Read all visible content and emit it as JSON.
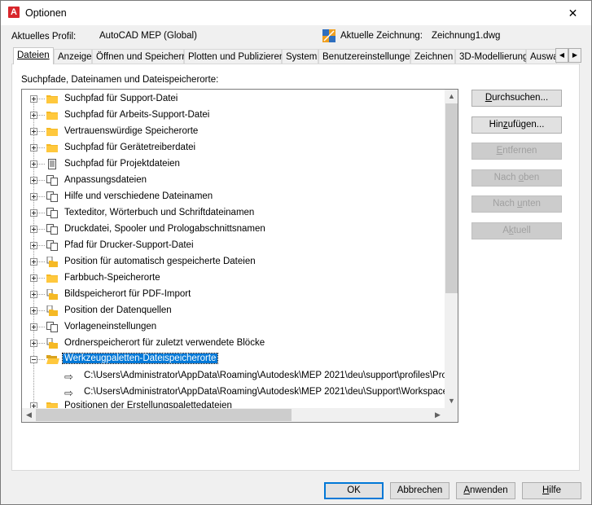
{
  "window": {
    "title": "Optionen",
    "close_glyph": "✕"
  },
  "profile": {
    "label": "Aktuelles Profil:",
    "value": "AutoCAD MEP (Global)",
    "drawing_label": "Aktuelle Zeichnung:",
    "drawing_value": "Zeichnung1.dwg"
  },
  "tabs": [
    "Dateien",
    "Anzeige",
    "Öffnen und Speichern",
    "Plotten und Publizieren",
    "System",
    "Benutzereinstellungen",
    "Zeichnen",
    "3D-Modellierung",
    "Auswa"
  ],
  "section_label": "Suchpfade, Dateinamen und Dateispeicherorte:",
  "tree": {
    "items": [
      {
        "label": "Suchpfad für Support-Datei",
        "icon": "folder-icon"
      },
      {
        "label": "Suchpfad für Arbeits-Support-Datei",
        "icon": "folder-icon"
      },
      {
        "label": "Vertrauenswürdige Speicherorte",
        "icon": "folder-icon"
      },
      {
        "label": "Suchpfad für Gerätetreiberdatei",
        "icon": "folder-icon"
      },
      {
        "label": "Suchpfad für Projektdateien",
        "icon": "document-stack-icon"
      },
      {
        "label": "Anpassungsdateien",
        "icon": "files-icon"
      },
      {
        "label": "Hilfe und verschiedene Dateinamen",
        "icon": "files-icon"
      },
      {
        "label": "Texteditor, Wörterbuch und Schriftdateinamen",
        "icon": "files-icon"
      },
      {
        "label": "Druckdatei, Spooler und Prologabschnittsnamen",
        "icon": "files-icon"
      },
      {
        "label": "Pfad für Drucker-Support-Datei",
        "icon": "files-icon"
      },
      {
        "label": "Position für automatisch gespeicherte Dateien",
        "icon": "folder-file-icon"
      },
      {
        "label": "Farbbuch-Speicherorte",
        "icon": "folder-icon"
      },
      {
        "label": "Bildspeicherort für PDF-Import",
        "icon": "folder-file-icon"
      },
      {
        "label": "Position der Datenquellen",
        "icon": "folder-file-icon"
      },
      {
        "label": "Vorlageneinstellungen",
        "icon": "files-icon"
      },
      {
        "label": "Ordnerspeicherort für zuletzt verwendete Blöcke",
        "icon": "folder-file-icon"
      },
      {
        "label": "Werkzeugpaletten-Dateispeicherorte",
        "icon": "open-folder-icon",
        "selected": true
      }
    ],
    "subitems": [
      "C:\\Users\\Administrator\\AppData\\Roaming\\Autodesk\\MEP 2021\\deu\\support\\profiles\\Projec",
      "C:\\Users\\Administrator\\AppData\\Roaming\\Autodesk\\MEP 2021\\deu\\Support\\WorkspaceCa"
    ],
    "partial_item": "Positionen der Erstellungspalettedateien"
  },
  "side_buttons": {
    "browse": {
      "pre": "",
      "key": "D",
      "post": "urchsuchen..."
    },
    "add": {
      "pre": "Hin",
      "key": "z",
      "post": "ufügen..."
    },
    "remove": {
      "pre": "",
      "key": "E",
      "post": "ntfernen"
    },
    "up": {
      "pre": "Nach ",
      "key": "o",
      "post": "ben"
    },
    "down": {
      "pre": "Nach ",
      "key": "u",
      "post": "nten"
    },
    "current": {
      "pre": "A",
      "key": "k",
      "post": "tuell"
    }
  },
  "bottom_buttons": {
    "ok": "OK",
    "cancel": "Abbrechen",
    "apply": {
      "pre": "",
      "key": "A",
      "post": "nwenden"
    },
    "help": {
      "pre": "",
      "key": "H",
      "post": "ilfe"
    }
  },
  "colors": {
    "selection": "#0078d7",
    "folder": "#f5b925",
    "app_red": "#d8262b"
  }
}
